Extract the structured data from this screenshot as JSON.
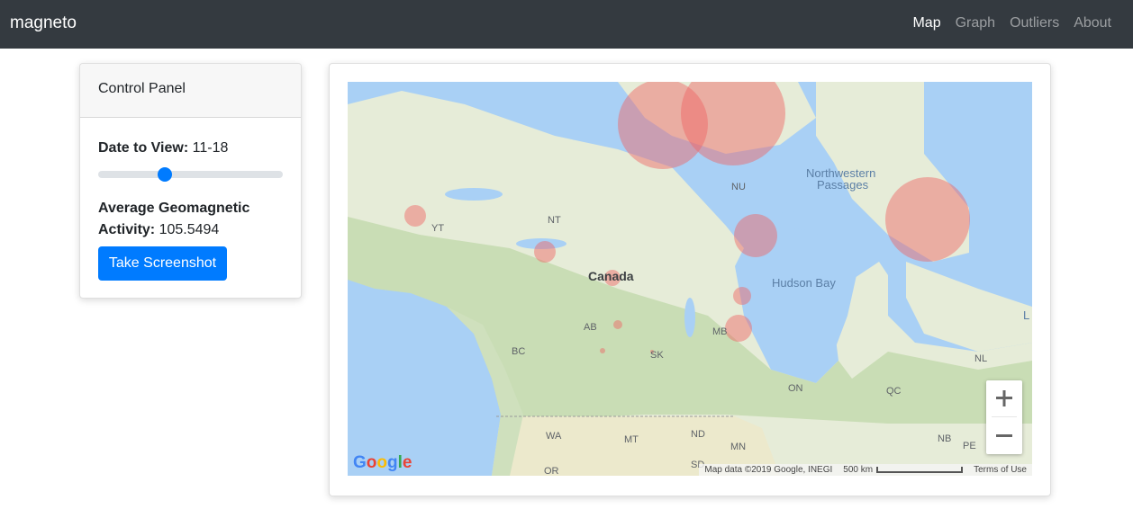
{
  "navbar": {
    "brand": "magneto",
    "links": [
      "Map",
      "Graph",
      "Outliers",
      "About"
    ],
    "active": "Map"
  },
  "control_panel": {
    "title": "Control Panel",
    "date_label": "Date to View:",
    "date_value": "11-18",
    "slider_fraction": 0.36,
    "avg_label": "Average Geomagnetic Activity:",
    "avg_value": "105.5494",
    "screenshot_button": "Take Screenshot"
  },
  "map": {
    "labels": {
      "canada": "Canada",
      "hudson_bay": "Hudson Bay",
      "northwestern_passages_1": "Northwestern",
      "northwestern_passages_2": "Passages",
      "nu": "NU",
      "nt": "NT",
      "yt": "YT",
      "bc": "BC",
      "ab": "AB",
      "sk": "SK",
      "mb": "MB",
      "on": "ON",
      "qc": "QC",
      "nl": "NL",
      "nb": "NB",
      "pe": "PE",
      "wa": "WA",
      "mt": "MT",
      "nd": "ND",
      "mn": "MN",
      "or": "OR",
      "sd": "SD",
      "l": "L"
    },
    "zoom_in": "+",
    "zoom_out": "−",
    "google_logo": "Google",
    "attribution": "Map data ©2019 Google, INEGI",
    "scale_label": "500 km",
    "terms": "Terms of Use",
    "colors": {
      "circle_fill": "#f06262",
      "land": "#dfe8d0",
      "water": "#a9d0f5",
      "forest": "#c8dcb4"
    }
  }
}
